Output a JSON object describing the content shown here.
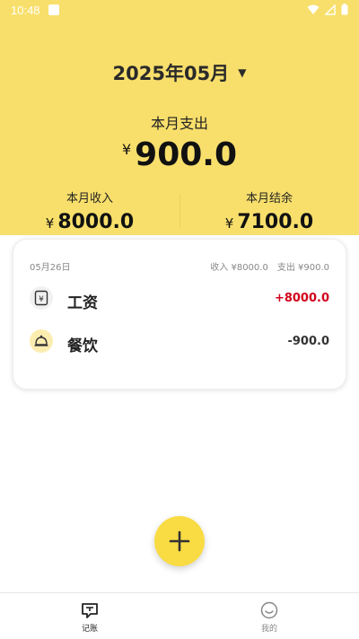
{
  "status_bar": {
    "time": "10:48"
  },
  "header": {
    "month": "2025年05月",
    "expense_label": "本月支出",
    "currency": "¥",
    "expense_value": "900.0",
    "income_label": "本月收入",
    "income_value": "8000.0",
    "balance_label": "本月结余",
    "balance_value": "7100.0"
  },
  "day_card": {
    "date": "05月26日",
    "income_summary": "收入 ¥8000.0",
    "expense_summary": "支出 ¥900.0",
    "records": [
      {
        "name": "工资",
        "amount": "+8000.0",
        "type": "income",
        "icon": "salary-icon"
      },
      {
        "name": "餐饮",
        "amount": "-900.0",
        "type": "expense",
        "icon": "dining-bell-icon"
      }
    ]
  },
  "bottom_nav": {
    "items": [
      {
        "label": "记账",
        "icon": "ledger-icon",
        "active": true
      },
      {
        "label": "我的",
        "icon": "smiley-profile-icon",
        "active": false
      }
    ]
  },
  "colors": {
    "header_bg": "#f8df6b",
    "fab_bg": "#f9db43",
    "income_text": "#d0021b"
  }
}
